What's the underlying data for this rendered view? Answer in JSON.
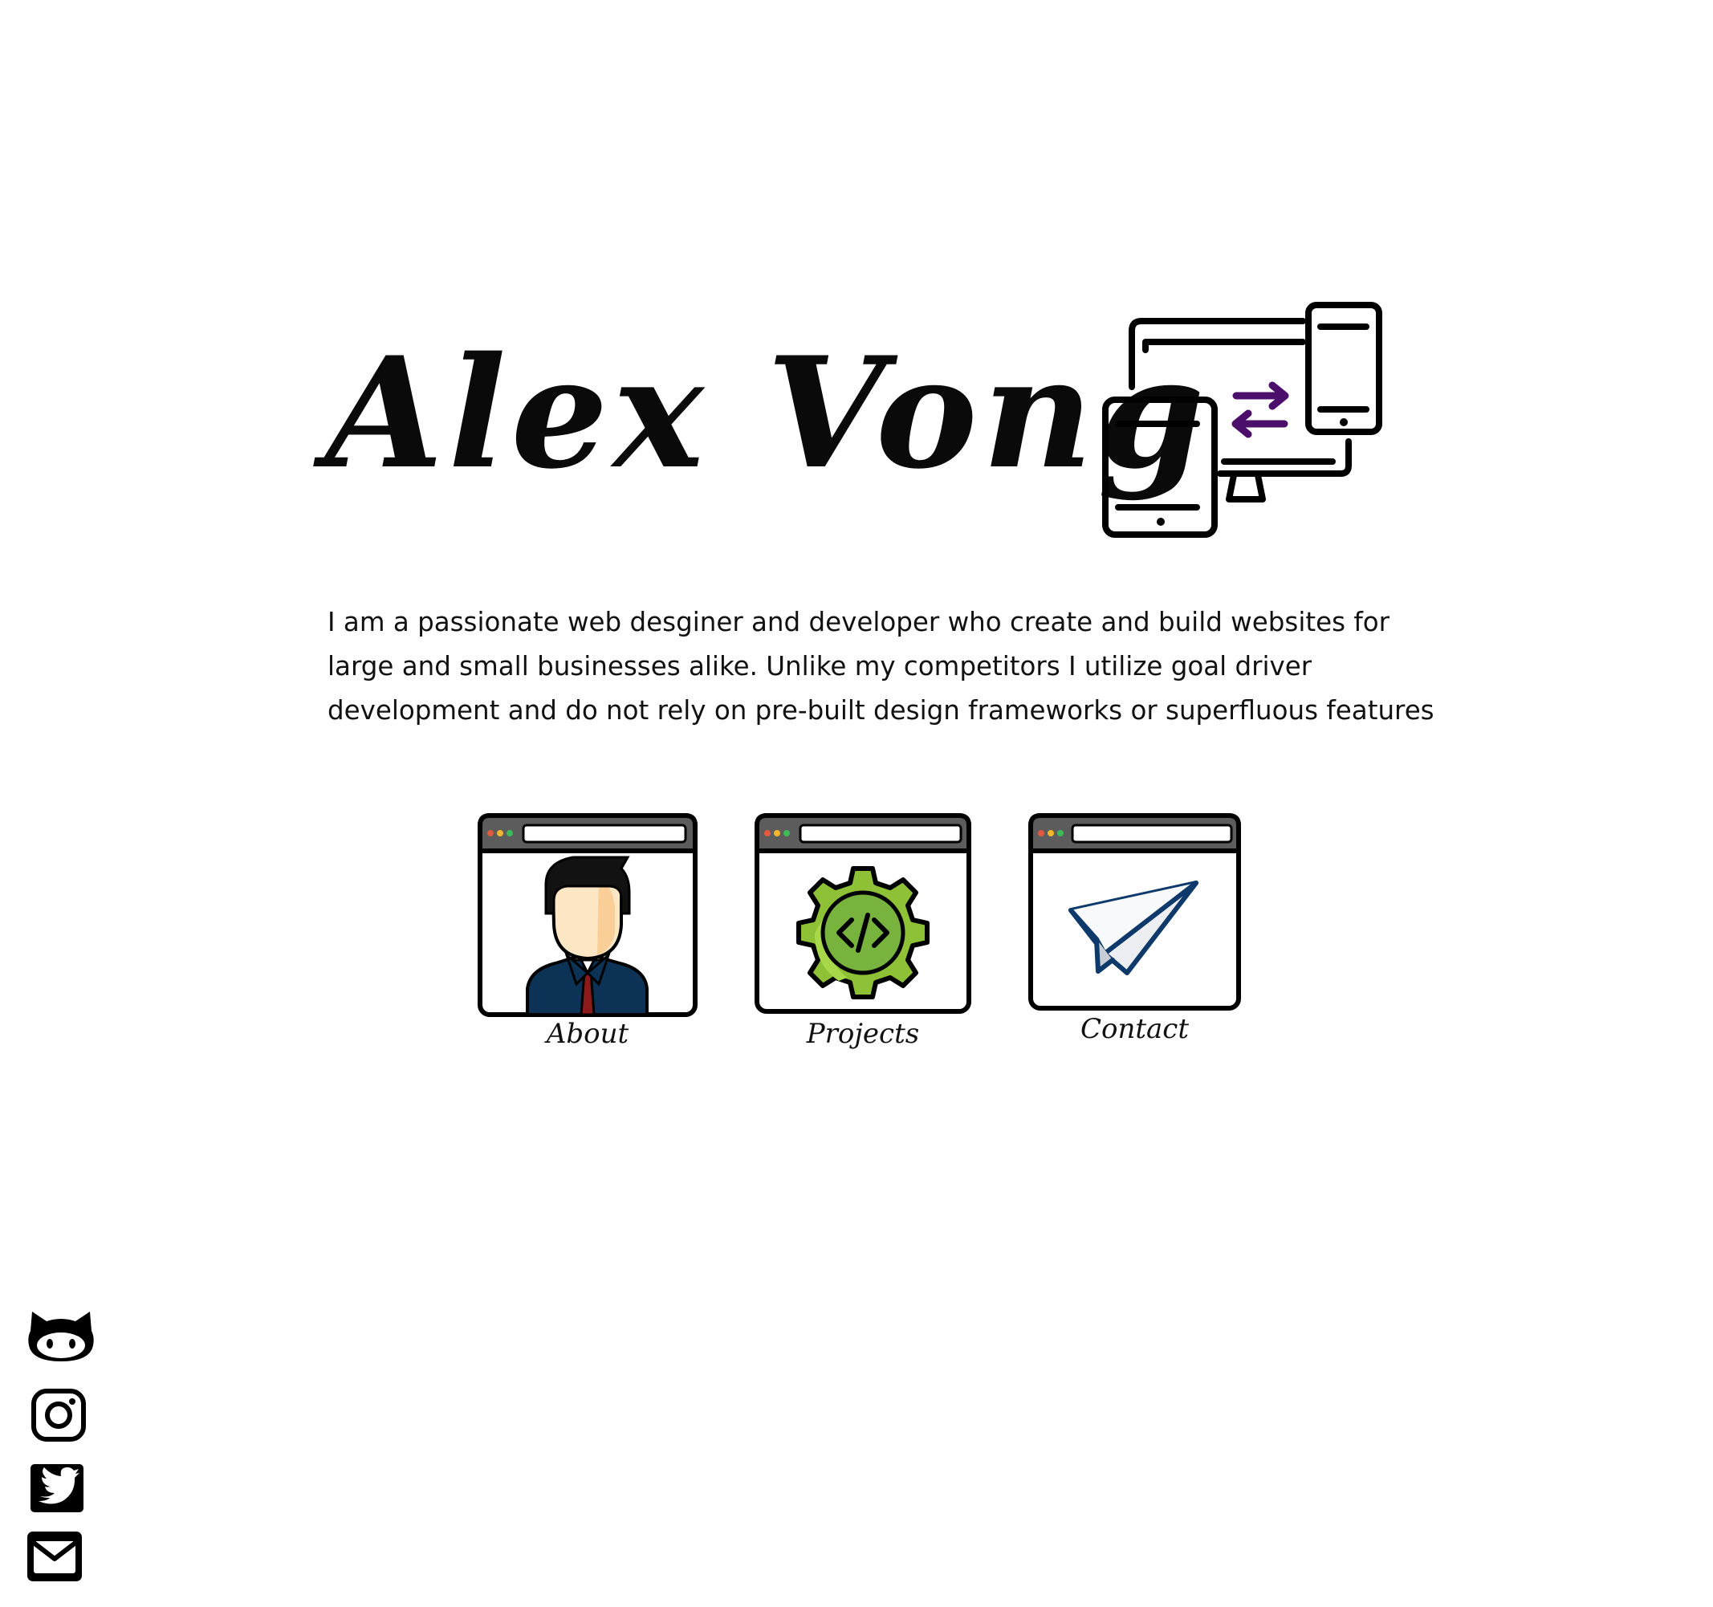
{
  "header": {
    "title": "Alex Vong",
    "logo_icon": "responsive-devices-icon",
    "accent_color": "#4b0e6b"
  },
  "intro": {
    "text": "I am a passionate web desginer and developer who create and build websites for large and small businesses alike. Unlike my competitors I utilize goal driver development and do not rely on pre-built design frameworks or superfluous features"
  },
  "nav": {
    "cards": [
      {
        "label": "About",
        "icon": "businessman-icon"
      },
      {
        "label": "Projects",
        "icon": "code-gear-icon"
      },
      {
        "label": "Contact",
        "icon": "paper-plane-icon"
      }
    ]
  },
  "social": {
    "links": [
      {
        "icon": "github-icon"
      },
      {
        "icon": "instagram-icon"
      },
      {
        "icon": "twitter-icon"
      },
      {
        "icon": "email-icon"
      }
    ]
  }
}
